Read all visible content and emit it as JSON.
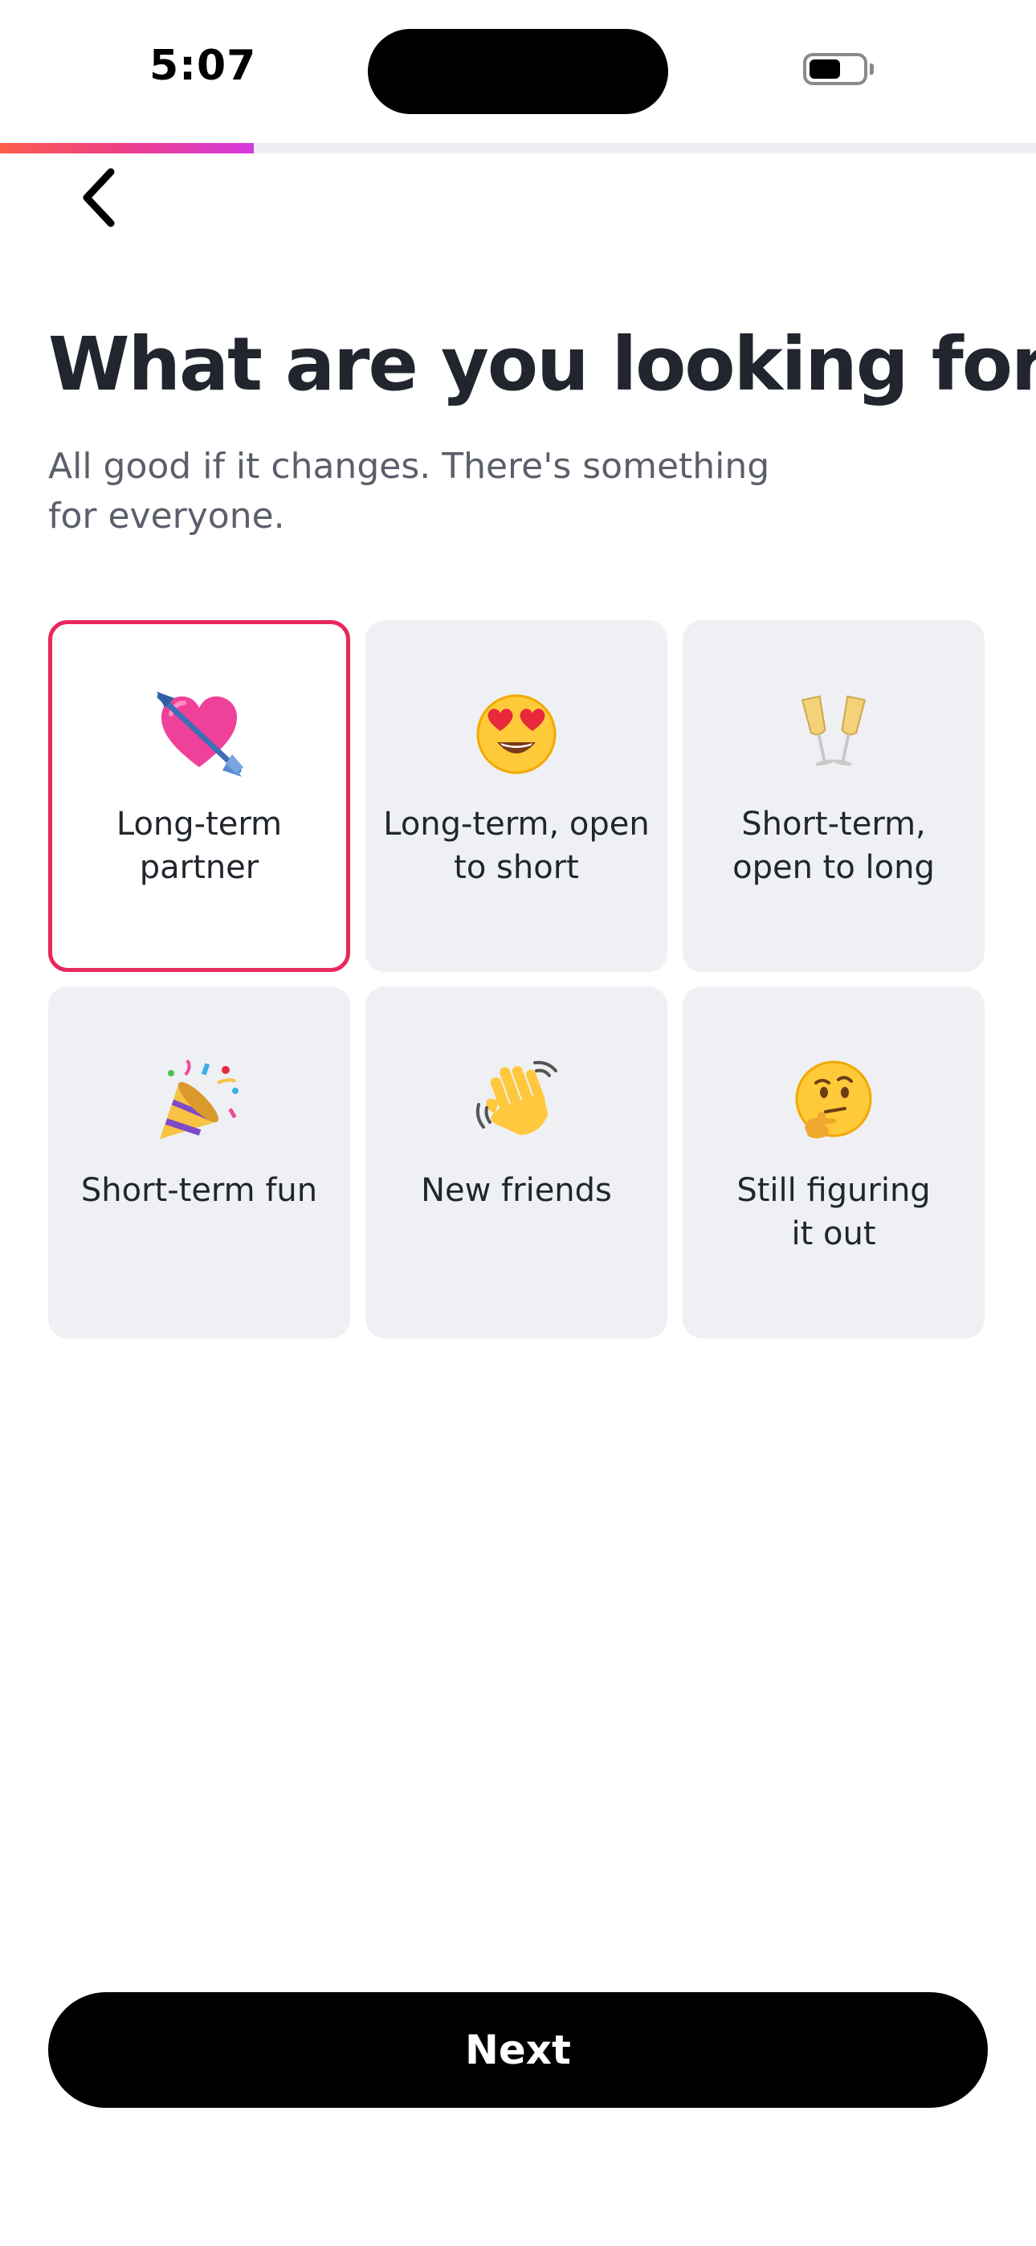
{
  "status_bar": {
    "time": "5:07",
    "battery_level": 0.6
  },
  "progress": {
    "fraction": 0.245,
    "colors": [
      "#fd5b4a",
      "#ec3d8a",
      "#d63be0"
    ],
    "track_color": "#eeeef3"
  },
  "back_button": {
    "icon": "chevron-left-icon"
  },
  "header": {
    "title": "What are you looking for?",
    "subtitle": "All good if it changes. There's something for everyone."
  },
  "options": [
    {
      "label": "Long-term\npartner",
      "icon": "heart-with-arrow-icon",
      "selected": true
    },
    {
      "label": "Long-term, open\nto short",
      "icon": "heart-eyes-face-icon",
      "selected": false
    },
    {
      "label": "Short-term,\nopen to long",
      "icon": "champagne-glasses-icon",
      "selected": false
    },
    {
      "label": "Short-term fun",
      "icon": "party-popper-icon",
      "selected": false
    },
    {
      "label": "New friends",
      "icon": "waving-hand-icon",
      "selected": false
    },
    {
      "label": "Still figuring\nit out",
      "icon": "thinking-face-icon",
      "selected": false
    }
  ],
  "colors": {
    "accent": "#e8285c",
    "card_bg": "#eff0f3",
    "title_text": "#21262e",
    "subtitle_text": "#5b5f6b",
    "button_bg": "#000000",
    "button_text": "#ffffff"
  },
  "next_button": {
    "label": "Next"
  }
}
